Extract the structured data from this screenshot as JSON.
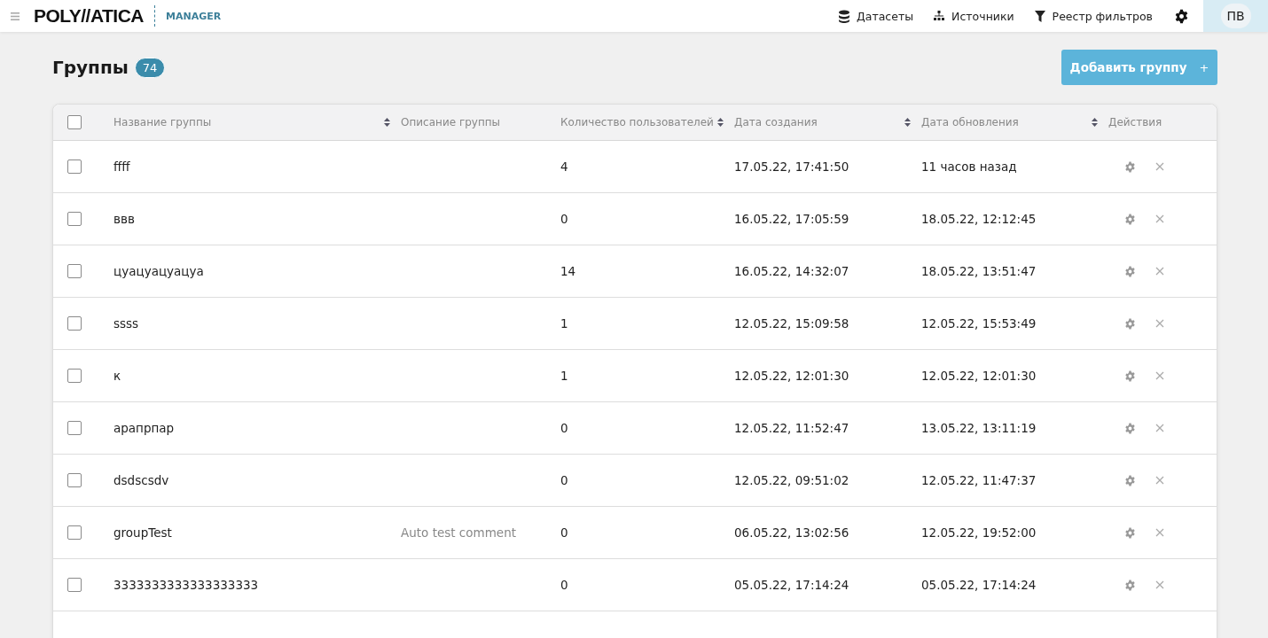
{
  "header": {
    "logo": "POLY//ATICA",
    "product": "MANAGER",
    "nav": [
      {
        "kind": "datasets",
        "label": "Датасеты"
      },
      {
        "kind": "sources",
        "label": "Источники"
      },
      {
        "kind": "filters",
        "label": "Реестр фильтров"
      }
    ],
    "user": "ПВ"
  },
  "page": {
    "title": "Группы",
    "count": "74",
    "add_button": "Добавить группу",
    "add_icon": "+"
  },
  "table": {
    "select_all": {
      "checked": false
    },
    "columns": [
      {
        "label": "Название группы",
        "sortable": true
      },
      {
        "label": "Описание группы",
        "sortable": false
      },
      {
        "label": "Количество пользователей",
        "sortable": true
      },
      {
        "label": "Дата создания",
        "sortable": true
      },
      {
        "label": "Дата обновления",
        "sortable": true
      },
      {
        "label": "Действия",
        "sortable": false
      }
    ],
    "rows": [
      {
        "checked": false,
        "name": "ffff",
        "description": "",
        "users": "4",
        "created": "17.05.22, 17:41:50",
        "updated": "11 часов назад"
      },
      {
        "checked": false,
        "name": "ввв",
        "description": "",
        "users": "0",
        "created": "16.05.22, 17:05:59",
        "updated": "18.05.22, 12:12:45"
      },
      {
        "checked": false,
        "name": "цуацуацуацуа",
        "description": "",
        "users": "14",
        "created": "16.05.22, 14:32:07",
        "updated": "18.05.22, 13:51:47"
      },
      {
        "checked": false,
        "name": "ssss",
        "description": "",
        "users": "1",
        "created": "12.05.22, 15:09:58",
        "updated": "12.05.22, 15:53:49"
      },
      {
        "checked": false,
        "name": "к",
        "description": "",
        "users": "1",
        "created": "12.05.22, 12:01:30",
        "updated": "12.05.22, 12:01:30"
      },
      {
        "checked": false,
        "name": "арапрпар",
        "description": "",
        "users": "0",
        "created": "12.05.22, 11:52:47",
        "updated": "13.05.22, 13:11:19"
      },
      {
        "checked": false,
        "name": "dsdscsdv",
        "description": "",
        "users": "0",
        "created": "12.05.22, 09:51:02",
        "updated": "12.05.22, 11:47:37"
      },
      {
        "checked": false,
        "name": "groupTest",
        "description": "Auto test comment",
        "users": "0",
        "created": "06.05.22, 13:02:56",
        "updated": "12.05.22, 19:52:00"
      },
      {
        "checked": false,
        "name": "3333333333333333333",
        "description": "",
        "users": "0",
        "created": "05.05.22, 17:14:24",
        "updated": "05.05.22, 17:14:24"
      }
    ]
  }
}
